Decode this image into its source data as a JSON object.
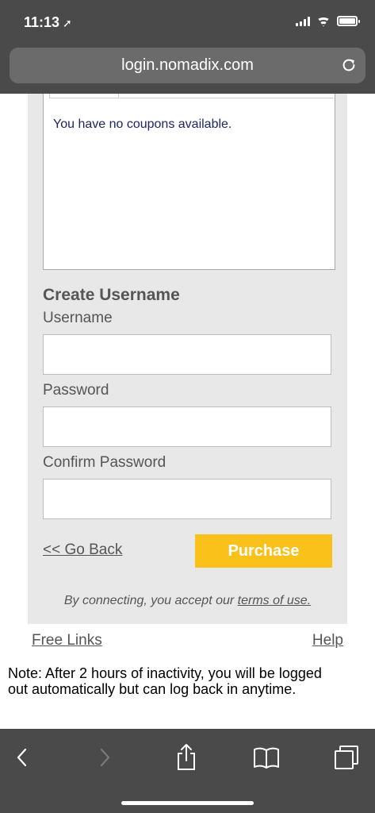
{
  "status_bar": {
    "time": "11:13",
    "location_icon": "location-arrow-icon"
  },
  "browser": {
    "url": "login.nomadix.com"
  },
  "coupons": {
    "message": "You have no coupons available."
  },
  "form": {
    "title": "Create Username",
    "username_label": "Username",
    "password_label": "Password",
    "confirm_label": "Confirm Password",
    "username_value": "",
    "password_value": "",
    "confirm_value": ""
  },
  "actions": {
    "go_back": "<< Go Back",
    "purchase": "Purchase"
  },
  "terms": {
    "prefix": "By connecting, you accept our ",
    "link": "terms of use."
  },
  "footer": {
    "free_links": "Free Links",
    "help": "Help",
    "note": "Note: After 2 hours of inactivity, you will be logged out automatically but can log back in anytime."
  },
  "colors": {
    "chrome": "#4a4a4a",
    "panel": "#e8e8e8",
    "purchase": "#f9c11a",
    "coupon_text": "#1c2566"
  }
}
